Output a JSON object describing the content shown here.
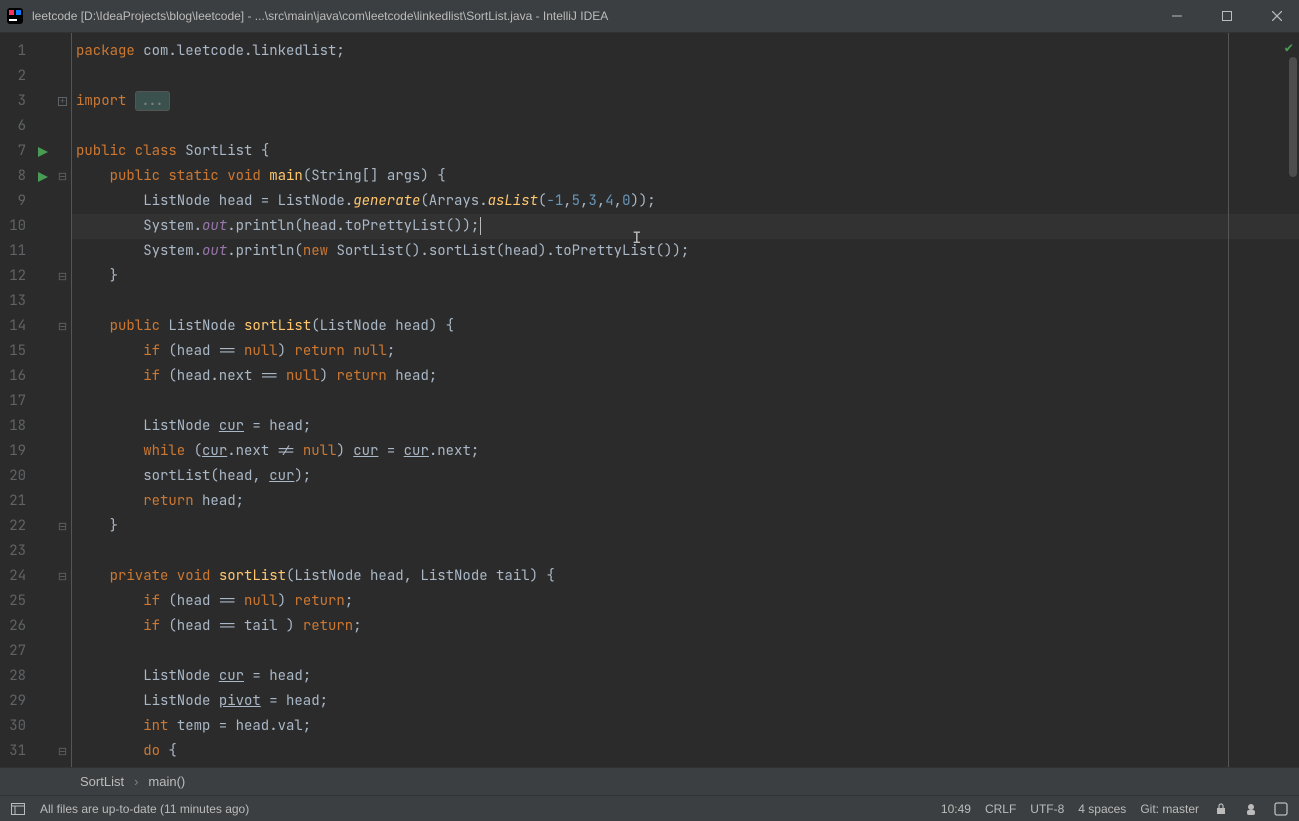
{
  "title": "leetcode [D:\\IdeaProjects\\blog\\leetcode] - ...\\src\\main\\java\\com\\leetcode\\linkedlist\\SortList.java - IntelliJ IDEA",
  "lines": [
    "1",
    "2",
    "3",
    "6",
    "7",
    "8",
    "9",
    "10",
    "11",
    "12",
    "13",
    "14",
    "15",
    "16",
    "17",
    "18",
    "19",
    "20",
    "21",
    "22",
    "23",
    "24",
    "25",
    "26",
    "27",
    "28",
    "29",
    "30",
    "31"
  ],
  "breadcrumb": {
    "class": "SortList",
    "method": "main()"
  },
  "status": {
    "left_icon": "hide-tool-windows-icon",
    "message": "All files are up-to-date (11 minutes ago)",
    "pos": "10:49",
    "lineend": "CRLF",
    "encoding": "UTF-8",
    "indent": "4 spaces",
    "git": "Git: master"
  },
  "code": {
    "l1_package": "package ",
    "l1_pkg": "com.leetcode.linkedlist",
    "l3_import": "import ",
    "l3_fold": "...",
    "l5_pub": "public class ",
    "l5_cls": "SortList ",
    "l6_sig1": "public static void ",
    "l6_main": "main",
    "l6_sig2": "(String[] args) {",
    "l7_a": "ListNode head = ListNode.",
    "l7_gen": "generate",
    "l7_b": "(Arrays.",
    "l7_as": "asList",
    "l7_c": "(",
    "l7_n1": "-1",
    "l7_n2": "5",
    "l7_n3": "3",
    "l7_n4": "4",
    "l7_n5": "0",
    "l7_d": "));",
    "l8_a": "System.",
    "l8_out": "out",
    "l8_b": ".println(head.toPrettyList());",
    "l9_a": "System.",
    "l9_out": "out",
    "l9_b": ".println(",
    "l9_new": "new ",
    "l9_c": "SortList().sortList(head).toPrettyList());",
    "l12_a": "public ",
    "l12_b": "ListNode ",
    "l12_fn": "sortList",
    "l12_c": "(ListNode head) {",
    "l13_a": "if ",
    "l13_b": "(head == ",
    "l13_null": "null",
    "l13_c": ") ",
    "l13_ret": "return ",
    "l13_null2": "null",
    "l14_a": "if ",
    "l14_b": "(head.next == ",
    "l14_null": "null",
    "l14_c": ") ",
    "l14_ret": "return ",
    "l14_d": "head;",
    "l16_a": "ListNode ",
    "l16_cur": "cur",
    "l16_b": " = head;",
    "l17_a": "while ",
    "l17_b": "(",
    "l17_cur": "cur",
    "l17_c": ".next != ",
    "l17_null": "null",
    "l17_d": ") ",
    "l17_cur2": "cur",
    "l17_e": " = ",
    "l17_cur3": "cur",
    "l17_f": ".next;",
    "l18_a": "sortList(head, ",
    "l18_cur": "cur",
    "l18_b": ");",
    "l19_ret": "return ",
    "l19_a": "head;",
    "l22_a": "private void ",
    "l22_fn": "sortList",
    "l22_b": "(ListNode head, ListNode tail) {",
    "l23_a": "if ",
    "l23_b": "(head == ",
    "l23_null": "null",
    "l23_c": ") ",
    "l23_ret": "return",
    "l24_a": "if ",
    "l24_b": "(head == tail ) ",
    "l24_ret": "return",
    "l26_a": "ListNode ",
    "l26_cur": "cur",
    "l26_b": " = head;",
    "l27_a": "ListNode ",
    "l27_piv": "pivot",
    "l27_b": " = head;",
    "l28_a": "int ",
    "l28_b": "temp = head.val;",
    "l29_a": "do ",
    "l29_b": "{"
  }
}
